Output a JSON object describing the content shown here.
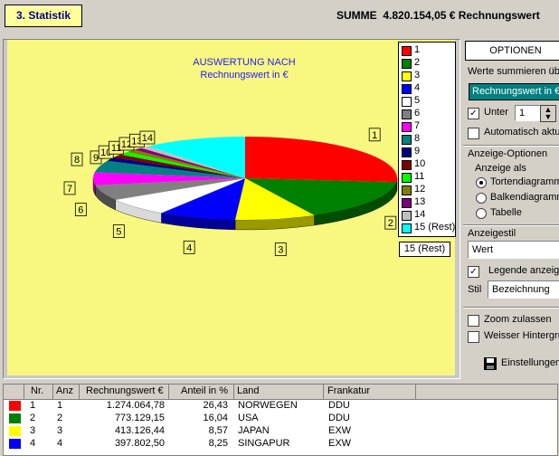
{
  "header": {
    "title": "3. Statistik",
    "summe_label": "SUMME",
    "summe_value": "4.820.154,05 € Rechnungswert"
  },
  "chart_data": {
    "type": "pie",
    "title": "AUSWERTUNG NACH",
    "subtitle": "Rechnungswert in €",
    "style": "3d",
    "legend_position": "right",
    "slices": [
      {
        "label": "1",
        "value": 26.43,
        "color": "#ff0000"
      },
      {
        "label": "2",
        "value": 16.04,
        "color": "#008000"
      },
      {
        "label": "3",
        "value": 8.57,
        "color": "#ffff00"
      },
      {
        "label": "4",
        "value": 8.25,
        "color": "#0000ff"
      },
      {
        "label": "5",
        "value": 7.0,
        "color": "#ffffff"
      },
      {
        "label": "6",
        "value": 6.0,
        "color": "#808080"
      },
      {
        "label": "7",
        "value": 5.0,
        "color": "#ff00ff"
      },
      {
        "label": "8",
        "value": 4.6,
        "color": "#008080"
      },
      {
        "label": "9",
        "value": 1.5,
        "color": "#000080"
      },
      {
        "label": "10",
        "value": 1.3,
        "color": "#800000"
      },
      {
        "label": "11",
        "value": 1.2,
        "color": "#00ff00"
      },
      {
        "label": "12",
        "value": 1.1,
        "color": "#808000"
      },
      {
        "label": "13",
        "value": 1.0,
        "color": "#800080"
      },
      {
        "label": "14",
        "value": 1.0,
        "color": "#c0c0c0"
      },
      {
        "label": "15 (Rest)",
        "value": 11.01,
        "color": "#00ffff"
      }
    ]
  },
  "legend": {
    "items": [
      {
        "label": "1",
        "color": "#ff0000"
      },
      {
        "label": "2",
        "color": "#008000"
      },
      {
        "label": "3",
        "color": "#ffff00"
      },
      {
        "label": "4",
        "color": "#0000ff"
      },
      {
        "label": "5",
        "color": "#ffffff"
      },
      {
        "label": "6",
        "color": "#808080"
      },
      {
        "label": "7",
        "color": "#ff00ff"
      },
      {
        "label": "8",
        "color": "#008080"
      },
      {
        "label": "9",
        "color": "#000080"
      },
      {
        "label": "10",
        "color": "#800000"
      },
      {
        "label": "11",
        "color": "#00ff00"
      },
      {
        "label": "12",
        "color": "#808000"
      },
      {
        "label": "13",
        "color": "#800080"
      },
      {
        "label": "14",
        "color": "#c0c0c0"
      },
      {
        "label": "15 (Rest)",
        "color": "#00ffff"
      }
    ]
  },
  "options": {
    "button_label": "OPTIONEN",
    "werte_label": "Werte summieren über",
    "werte_value": "Rechnungswert in €",
    "unter_label": "Unter",
    "unter_value": "1",
    "unter_checked": "✓",
    "auto_label": "Automatisch aktualisieren",
    "anzeige_optionen_label": "Anzeige-Optionen",
    "anzeige_als_label": "Anzeige als",
    "radio_torten": "Tortendiagramm",
    "radio_balken": "Balkendiagramm",
    "radio_tabelle": "Tabelle",
    "anzeigestil_label": "Anzeigestil",
    "anzeigestil_value": "Wert",
    "legende_label": "Legende anzeigen",
    "legende_checked": "✓",
    "stil_label": "Stil",
    "stil_value": "Bezeichnung",
    "zoom_label": "Zoom zulassen",
    "weisser_label": "Weisser Hintergrund",
    "einstellungen_label": "Einstellungen"
  },
  "table": {
    "headers": [
      "Nr.",
      "Anz",
      "Rechnungswert €",
      "Anteil in %",
      "Land",
      "Frankatur"
    ],
    "rows": [
      {
        "color": "#ff0000",
        "nr": "1",
        "anz": "1",
        "wert": "1.274.064,78",
        "anteil": "26,43",
        "land": "NORWEGEN",
        "frankatur": "DDU"
      },
      {
        "color": "#008000",
        "nr": "2",
        "anz": "2",
        "wert": "773.129,15",
        "anteil": "16,04",
        "land": "USA",
        "frankatur": "DDU"
      },
      {
        "color": "#ffff00",
        "nr": "3",
        "anz": "3",
        "wert": "413.126,44",
        "anteil": "8,57",
        "land": "JAPAN",
        "frankatur": "EXW"
      },
      {
        "color": "#0000ff",
        "nr": "4",
        "anz": "4",
        "wert": "397.802,50",
        "anteil": "8,25",
        "land": "SINGAPUR",
        "frankatur": "EXW"
      }
    ]
  }
}
